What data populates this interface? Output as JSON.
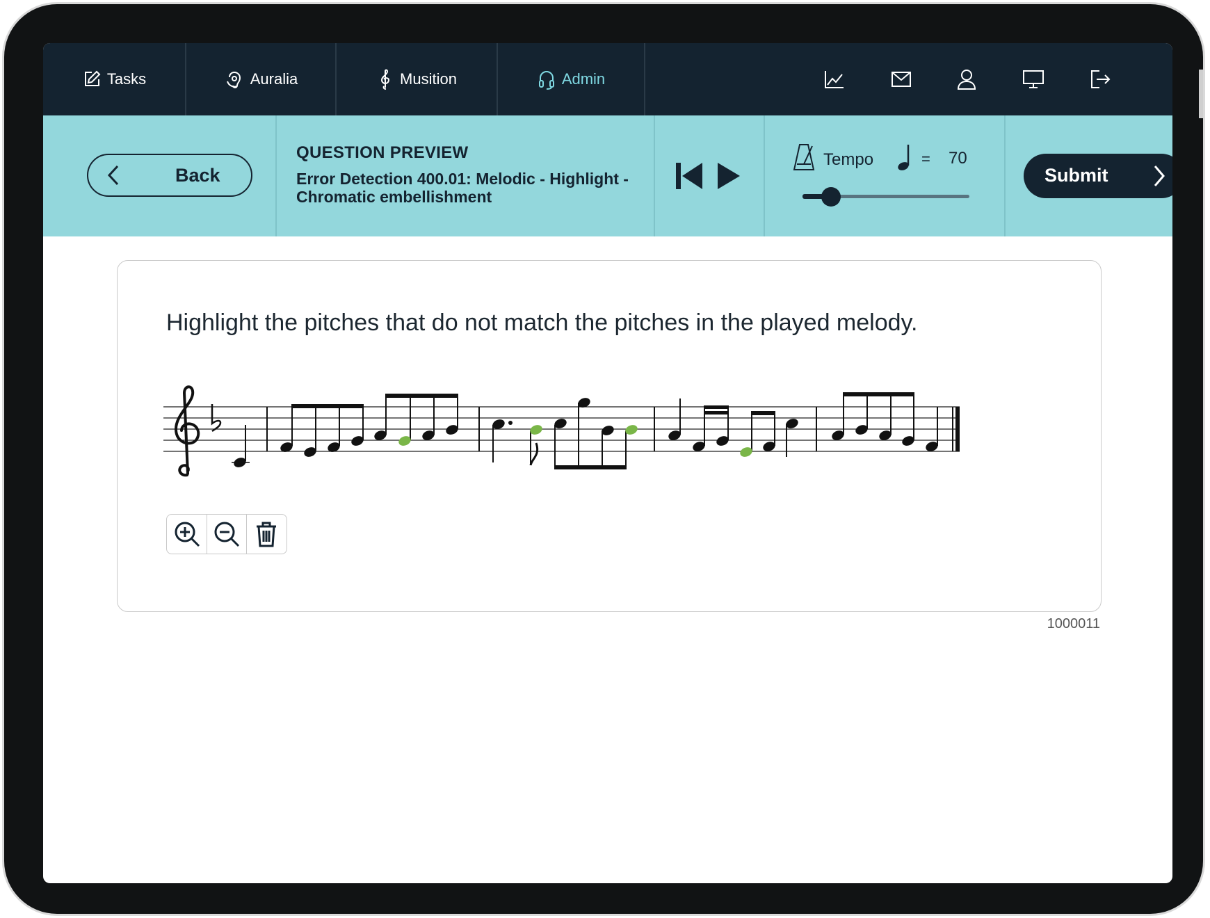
{
  "nav": {
    "items": [
      {
        "label": "Tasks",
        "icon": "edit-icon"
      },
      {
        "label": "Auralia",
        "icon": "ear-icon"
      },
      {
        "label": "Musition",
        "icon": "treble-clef-icon"
      },
      {
        "label": "Admin",
        "icon": "headphones-icon"
      }
    ],
    "right_icons": [
      "chart-icon",
      "mail-icon",
      "user-icon",
      "monitor-icon",
      "logout-icon"
    ]
  },
  "toolbar": {
    "back_label": "Back",
    "preview_heading": "QUESTION PREVIEW",
    "question_title": "Error Detection 400.01: Melodic - Highlight - Chromatic embellishment",
    "tempo_label": "Tempo",
    "tempo_equals": "=",
    "tempo_value": "70",
    "tempo_slider_fraction": 0.17,
    "submit_label": "Submit"
  },
  "card": {
    "prompt": "Highlight the pitches that do not match the pitches in the played melody.",
    "highlight_color": "#7ab648",
    "clef": "treble",
    "key_signature": "1 flat (B♭)"
  },
  "question_id": "1000011",
  "colors": {
    "nav_bg": "#142330",
    "toolbar_bg": "#93d7dc",
    "accent": "#7fd8e2"
  }
}
